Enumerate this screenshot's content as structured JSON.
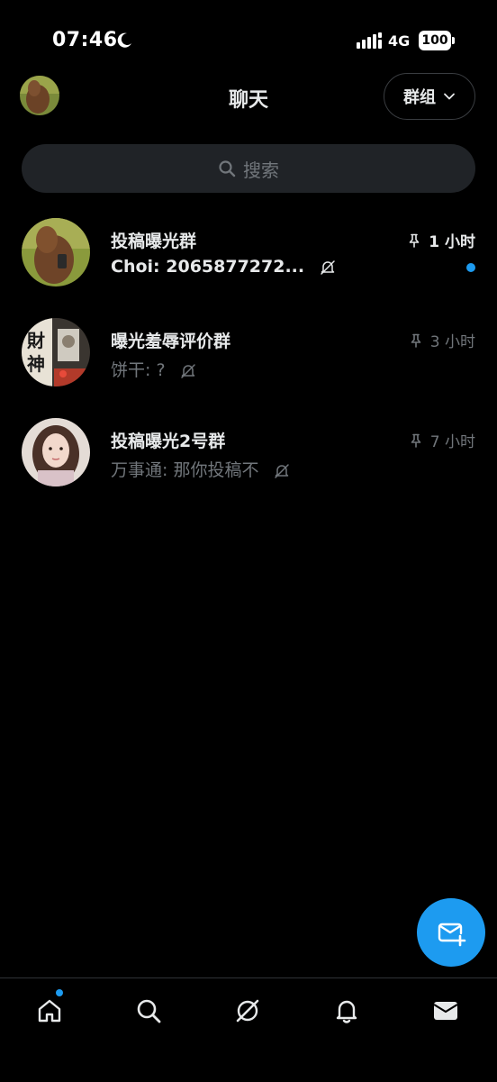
{
  "status_bar": {
    "time": "07:46",
    "network": "4G",
    "battery": "100"
  },
  "header": {
    "title": "聊天",
    "groups_label": "群组"
  },
  "search": {
    "placeholder": "搜索"
  },
  "chats": [
    {
      "name": "投稿曝光群",
      "preview": "Choi: 2065877272...",
      "time": "1 小时",
      "pinned": true,
      "muted": true,
      "unread": true
    },
    {
      "name": "曝光羞辱评价群",
      "preview": "饼干: ?",
      "time": "3 小时",
      "pinned": true,
      "muted": true,
      "unread": false
    },
    {
      "name": "投稿曝光2号群",
      "preview": "万事通: 那你投稿不",
      "time": "7 小时",
      "pinned": true,
      "muted": true,
      "unread": false
    }
  ],
  "colors": {
    "accent": "#1d9bf0",
    "background": "#000000",
    "primary_text": "#e7e9ea",
    "secondary_text": "#71767b",
    "search_bg": "#202327"
  },
  "nav": [
    {
      "icon": "home-icon",
      "has_notification_dot": true
    },
    {
      "icon": "search-icon"
    },
    {
      "icon": "grok-icon"
    },
    {
      "icon": "bell-icon"
    },
    {
      "icon": "mail-icon",
      "active": true
    }
  ]
}
